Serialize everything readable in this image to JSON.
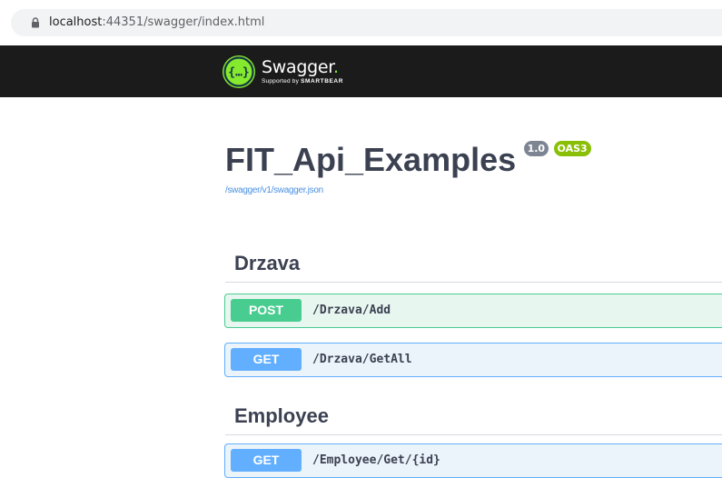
{
  "browser": {
    "url_host": "localhost",
    "url_rest": ":44351/swagger/index.html",
    "lock_icon": "lock-icon"
  },
  "topbar": {
    "logo_icon": "swagger-logo-icon",
    "title": "Swagger",
    "title_dot": ".",
    "subtitle_prefix": "Supported by",
    "subtitle_brand": "SMARTBEAR",
    "brand_color": "#85ea2d",
    "background": "#1b1b1b"
  },
  "info": {
    "title": "FIT_Api_Examples",
    "version_badge": "1.0",
    "oas_badge": "OAS3",
    "spec_link": "/swagger/v1/swagger.json"
  },
  "tags": [
    {
      "name": "Drzava",
      "operations": [
        {
          "method": "POST",
          "path": "/Drzava/Add"
        },
        {
          "method": "GET",
          "path": "/Drzava/GetAll"
        }
      ]
    },
    {
      "name": "Employee",
      "operations": [
        {
          "method": "GET",
          "path": "/Employee/Get/{id}"
        }
      ]
    }
  ],
  "colors": {
    "post": "#49cc90",
    "get": "#61affe",
    "text": "#3b4151",
    "link": "#4990e2",
    "version_badge": "#7d8492",
    "oas_badge": "#89bf04"
  }
}
